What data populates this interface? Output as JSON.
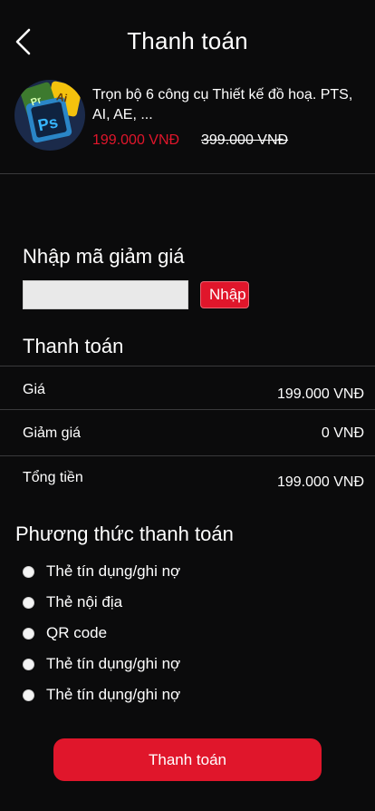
{
  "header": {
    "title": "Thanh toán",
    "back_icon": "chevron-left-icon"
  },
  "course": {
    "title": "Trọn bộ 6 công cụ Thiết kế đồ hoạ. PTS, AI, AE, ...",
    "price_new": "199.000 VNĐ",
    "price_old": "399.000 VNĐ",
    "thumb_badge_1": "Ps",
    "thumb_badge_2": "Ai",
    "thumb_badge_3": "Pr"
  },
  "coupon": {
    "heading": "Nhập mã giảm giá",
    "value": "",
    "placeholder": "",
    "apply_label": "Nhập"
  },
  "summary": {
    "heading": "Thanh toán",
    "rows": [
      {
        "label": "Giá",
        "value": "199.000 VNĐ"
      },
      {
        "label": "Giảm giá",
        "value": "0 VNĐ"
      },
      {
        "label": "Tổng tiền",
        "value": "199.000 VNĐ"
      }
    ]
  },
  "payment": {
    "heading": "Phương thức thanh toán",
    "options": [
      "Thẻ tín dụng/ghi nợ",
      "Thẻ nội địa",
      "QR code",
      "Thẻ tín dụng/ghi nợ",
      "Thẻ tín dụng/ghi nợ"
    ],
    "selected_index": -1
  },
  "actions": {
    "pay_label": "Thanh toán"
  },
  "colors": {
    "background": "#0b0b0c",
    "accent": "#e0162b",
    "divider": "#3a3a3c"
  }
}
